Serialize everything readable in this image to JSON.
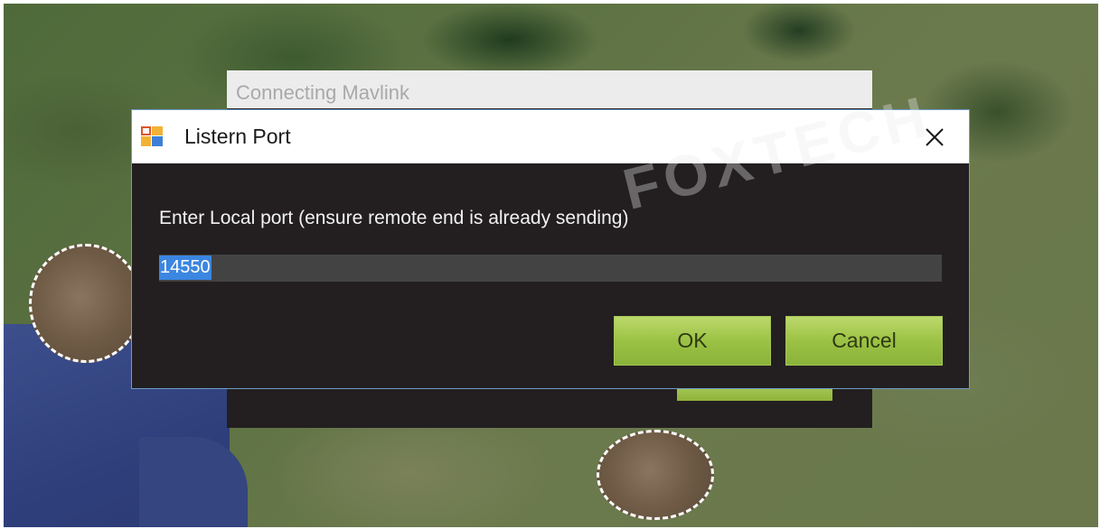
{
  "background_window": {
    "title": "Connecting Mavlink"
  },
  "dialog": {
    "title": "Listern Port",
    "watermark": "FOXTECH",
    "prompt": "Enter Local port (ensure remote end is already sending)",
    "port_value": "14550",
    "ok_label": "OK",
    "cancel_label": "Cancel",
    "close_glyph": "✕"
  },
  "icons": {
    "app": "window-app-icon",
    "close": "close-icon"
  },
  "colors": {
    "dialog_bg": "#231f20",
    "button_green": "#9cc244",
    "selection_blue": "#3b86e0",
    "input_bg": "#434343"
  }
}
